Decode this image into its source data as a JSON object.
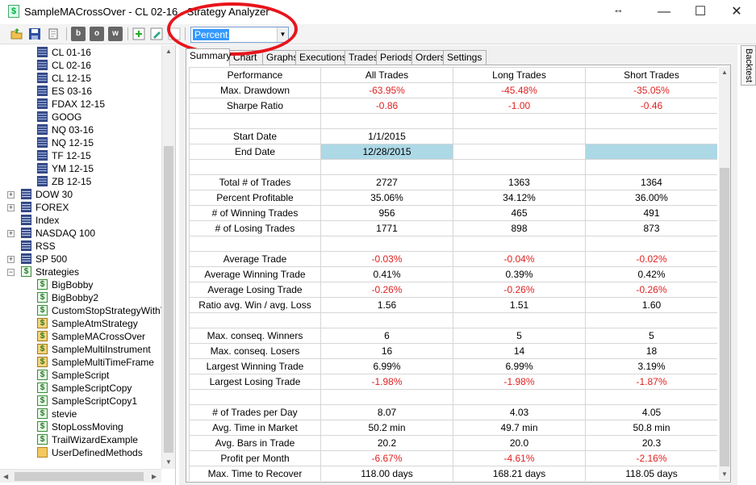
{
  "window": {
    "title": "SampleMACrossOver - CL 02-16 - Strategy Analyzer",
    "minimize": "—",
    "maximize": "☐",
    "close": "✕",
    "resize_glyph": "↔"
  },
  "toolbar": {
    "buttons": [
      "open-icon",
      "save-icon",
      "print-icon",
      "b",
      "o",
      "w",
      "add-icon",
      "edit-icon",
      "remove-icon"
    ],
    "display_select": {
      "value": "Percent",
      "options_visible": [
        "Percent"
      ]
    }
  },
  "tree": {
    "items": [
      {
        "label": "CL 01-16",
        "type": "instrument",
        "indent": 2
      },
      {
        "label": "CL 02-16",
        "type": "instrument",
        "indent": 2
      },
      {
        "label": "CL 12-15",
        "type": "instrument",
        "indent": 2
      },
      {
        "label": "ES 03-16",
        "type": "instrument",
        "indent": 2
      },
      {
        "label": "FDAX 12-15",
        "type": "instrument",
        "indent": 2
      },
      {
        "label": "GOOG",
        "type": "instrument",
        "indent": 2
      },
      {
        "label": "NQ 03-16",
        "type": "instrument",
        "indent": 2
      },
      {
        "label": "NQ 12-15",
        "type": "instrument",
        "indent": 2
      },
      {
        "label": "TF 12-15",
        "type": "instrument",
        "indent": 2
      },
      {
        "label": "YM 12-15",
        "type": "instrument",
        "indent": 2
      },
      {
        "label": "ZB 12-15",
        "type": "instrument",
        "indent": 2
      },
      {
        "label": "DOW 30",
        "type": "list",
        "indent": 1,
        "expander": "+"
      },
      {
        "label": "FOREX",
        "type": "list",
        "indent": 1,
        "expander": "+"
      },
      {
        "label": "Index",
        "type": "list",
        "indent": 1
      },
      {
        "label": "NASDAQ 100",
        "type": "list",
        "indent": 1,
        "expander": "+"
      },
      {
        "label": "RSS",
        "type": "list",
        "indent": 1
      },
      {
        "label": "SP 500",
        "type": "list",
        "indent": 1,
        "expander": "+"
      },
      {
        "label": "Strategies",
        "type": "script",
        "indent": 1,
        "expander": "−"
      },
      {
        "label": "BigBobby",
        "type": "script",
        "indent": 2
      },
      {
        "label": "BigBobby2",
        "type": "script",
        "indent": 2
      },
      {
        "label": "CustomStopStrategyWithTra",
        "type": "script",
        "indent": 2
      },
      {
        "label": "SampleAtmStrategy",
        "type": "atm",
        "indent": 2
      },
      {
        "label": "SampleMACrossOver",
        "type": "atm",
        "indent": 2
      },
      {
        "label": "SampleMultiInstrument",
        "type": "atm",
        "indent": 2
      },
      {
        "label": "SampleMultiTimeFrame",
        "type": "atm",
        "indent": 2
      },
      {
        "label": "SampleScript",
        "type": "script",
        "indent": 2
      },
      {
        "label": "SampleScriptCopy",
        "type": "script",
        "indent": 2
      },
      {
        "label": "SampleScriptCopy1",
        "type": "script",
        "indent": 2
      },
      {
        "label": "stevie",
        "type": "script",
        "indent": 2
      },
      {
        "label": "StopLossMoving",
        "type": "script",
        "indent": 2
      },
      {
        "label": "TrailWizardExample",
        "type": "script",
        "indent": 2
      },
      {
        "label": "UserDefinedMethods",
        "type": "folder",
        "indent": 2
      }
    ]
  },
  "tabs": [
    "Summary",
    "Chart",
    "Graphs",
    "Executions",
    "Trades",
    "Periods",
    "Orders",
    "Settings"
  ],
  "active_tab": "Summary",
  "side_tab": "Backtest",
  "grid": {
    "columns": [
      "Performance",
      "All Trades",
      "Long Trades",
      "Short Trades"
    ],
    "rows": [
      {
        "label": "Max. Drawdown",
        "all": "-63.95%",
        "long": "-45.48%",
        "short": "-35.05%",
        "neg": true
      },
      {
        "label": "Sharpe Ratio",
        "all": "-0.86",
        "long": "-1.00",
        "short": "-0.46",
        "neg": true
      },
      {
        "label": "",
        "all": "",
        "long": "",
        "short": ""
      },
      {
        "label": "Start Date",
        "all": "1/1/2015",
        "long": "",
        "short": ""
      },
      {
        "label": "End Date",
        "all": "12/28/2015",
        "long": "",
        "short": "",
        "highlight": true
      },
      {
        "label": "",
        "all": "",
        "long": "",
        "short": ""
      },
      {
        "label": "Total # of Trades",
        "all": "2727",
        "long": "1363",
        "short": "1364"
      },
      {
        "label": "Percent Profitable",
        "all": "35.06%",
        "long": "34.12%",
        "short": "36.00%"
      },
      {
        "label": "# of Winning Trades",
        "all": "956",
        "long": "465",
        "short": "491"
      },
      {
        "label": "# of Losing Trades",
        "all": "1771",
        "long": "898",
        "short": "873"
      },
      {
        "label": "",
        "all": "",
        "long": "",
        "short": ""
      },
      {
        "label": "Average Trade",
        "all": "-0.03%",
        "long": "-0.04%",
        "short": "-0.02%",
        "neg": true
      },
      {
        "label": "Average Winning Trade",
        "all": "0.41%",
        "long": "0.39%",
        "short": "0.42%"
      },
      {
        "label": "Average Losing Trade",
        "all": "-0.26%",
        "long": "-0.26%",
        "short": "-0.26%",
        "neg": true
      },
      {
        "label": "Ratio avg. Win / avg. Loss",
        "all": "1.56",
        "long": "1.51",
        "short": "1.60"
      },
      {
        "label": "",
        "all": "",
        "long": "",
        "short": ""
      },
      {
        "label": "Max. conseq. Winners",
        "all": "6",
        "long": "5",
        "short": "5"
      },
      {
        "label": "Max. conseq. Losers",
        "all": "16",
        "long": "14",
        "short": "18"
      },
      {
        "label": "Largest Winning Trade",
        "all": "6.99%",
        "long": "6.99%",
        "short": "3.19%"
      },
      {
        "label": "Largest Losing Trade",
        "all": "-1.98%",
        "long": "-1.98%",
        "short": "-1.87%",
        "neg": true
      },
      {
        "label": "",
        "all": "",
        "long": "",
        "short": ""
      },
      {
        "label": "# of Trades per Day",
        "all": "8.07",
        "long": "4.03",
        "short": "4.05"
      },
      {
        "label": "Avg. Time in Market",
        "all": "50.2 min",
        "long": "49.7 min",
        "short": "50.8 min"
      },
      {
        "label": "Avg. Bars in Trade",
        "all": "20.2",
        "long": "20.0",
        "short": "20.3"
      },
      {
        "label": "Profit per Month",
        "all": "-6.67%",
        "long": "-4.61%",
        "short": "-2.16%",
        "neg": true
      },
      {
        "label": "Max. Time to Recover",
        "all": "118.00 days",
        "long": "168.21 days",
        "short": "118.05 days"
      }
    ]
  },
  "colors": {
    "negative": "#e02020",
    "highlight": "#add8e6",
    "annotation": "#e8141b",
    "select_highlight": "#3399ff"
  }
}
